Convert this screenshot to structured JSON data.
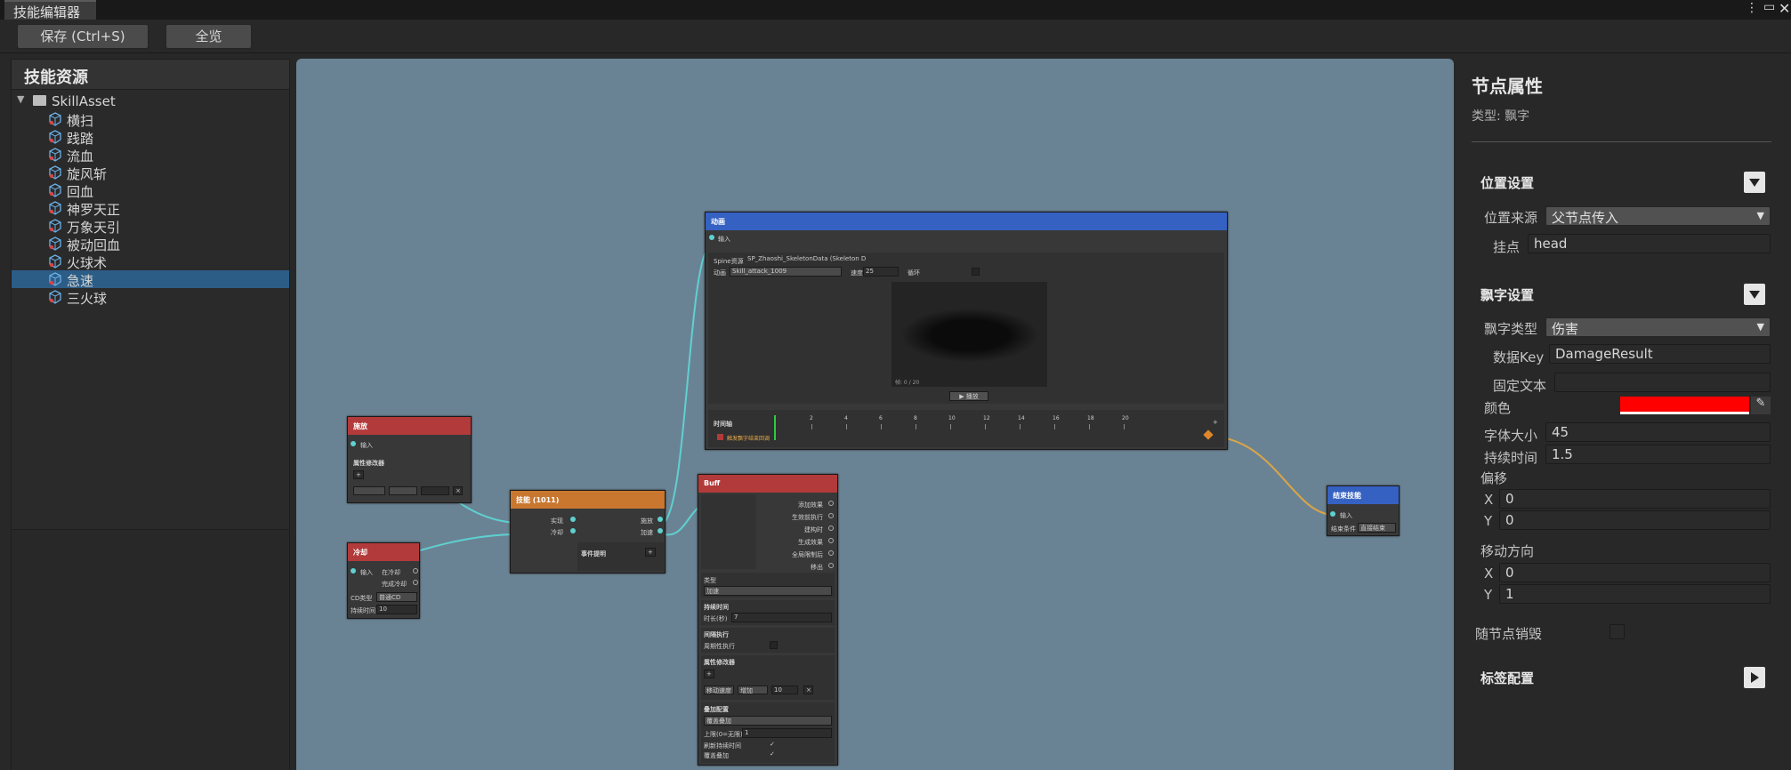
{
  "window": {
    "title": "技能编辑器"
  },
  "toolbar": {
    "save_label": "保存 (Ctrl+S)",
    "overview_label": "全览"
  },
  "left": {
    "header": "技能资源",
    "root": "SkillAsset",
    "items": [
      "横扫",
      "践踏",
      "流血",
      "旋风斩",
      "回血",
      "神罗天正",
      "万象天引",
      "被动回血",
      "火球术",
      "急速",
      "三火球"
    ],
    "selected": "急速"
  },
  "graph": {
    "node_anim": {
      "title": "动画",
      "input": "输入",
      "spine_label": "Spine资源",
      "spine_value": "SP_Zhaoshi_SkeletonData (Skeleton D",
      "anim_label": "动画",
      "anim_value": "Skill_attack_1009",
      "speed_label": "速度",
      "speed_value": "25",
      "loop_label": "循环",
      "frame_label": "帧: 0 / 20",
      "play_label": "▶ 播放",
      "timeline_label": "时间轴",
      "ticks": [
        "2",
        "4",
        "6",
        "8",
        "10",
        "12",
        "14",
        "16",
        "18",
        "20"
      ],
      "track_label": "触发飘字结束回调"
    },
    "node_release": {
      "title": "施放",
      "input": "输入",
      "section": "属性修改器"
    },
    "node_check": {
      "title": "技能 (1011)",
      "in1": "实现",
      "in2": "冷却",
      "out1": "施放",
      "out2": "加速",
      "event": "事件提明"
    },
    "node_cd": {
      "title": "冷却",
      "input": "输入",
      "out1": "在冷却",
      "out2": "完成冷却",
      "cd_type_label": "CD类型",
      "cd_type_value": "普通CD",
      "time_label": "持续时间",
      "time_value": "10"
    },
    "node_buff": {
      "title": "Buff",
      "input": "输入",
      "outs": [
        "添加效果",
        "生效前执行",
        "建构时",
        "生成效果",
        "全局限制后",
        "移出"
      ],
      "type_label": "类型",
      "type_value": "加速",
      "dur_section": "持续时间",
      "dur_label": "时长(秒)",
      "dur_value": "7",
      "exec_section": "间隔执行",
      "exec_label": "周期性执行",
      "mod_section": "属性修改器",
      "mod_attr": "移动速度",
      "mod_op": "增加",
      "mod_val": "10",
      "stack_section": "叠加配置",
      "stack_value": "覆盖叠加",
      "stack_max_label": "上限(0=无限)",
      "stack_max_value": "1",
      "reset_label": "刷新持续时间",
      "replace_label": "覆盖叠加"
    },
    "node_end": {
      "title": "结束技能",
      "input": "输入",
      "mode_label": "结束条件",
      "mode_value": "直接结束"
    }
  },
  "right": {
    "title": "节点属性",
    "type_text": "类型: 飘字",
    "pos_section": "位置设置",
    "pos_source_label": "位置来源",
    "pos_source_value": "父节点传入",
    "mount_label": "挂点",
    "mount_value": "head",
    "float_section": "飘字设置",
    "float_type_label": "飘字类型",
    "float_type_value": "伤害",
    "data_key_label": "数据Key",
    "data_key_value": "DamageResult",
    "fixed_text_label": "固定文本",
    "fixed_text_value": "",
    "color_label": "颜色",
    "color_value": "#ff0000",
    "font_size_label": "字体大小",
    "font_size_value": "45",
    "duration_label": "持续时间",
    "duration_value": "1.5",
    "offset_label": "偏移",
    "offset_x": "0",
    "offset_y": "0",
    "move_label": "移动方向",
    "move_x": "0",
    "move_y": "1",
    "x_label": "X",
    "y_label": "Y",
    "destroy_label": "随节点销毁",
    "tag_section": "标签配置"
  },
  "colors": {
    "graph_bg": "#6a8394",
    "selection": "#2c5d87",
    "accent_red": "#b33a3a",
    "accent_blue": "#3561c2",
    "accent_orange": "#c9772f",
    "wire": "#5fd0d0"
  }
}
